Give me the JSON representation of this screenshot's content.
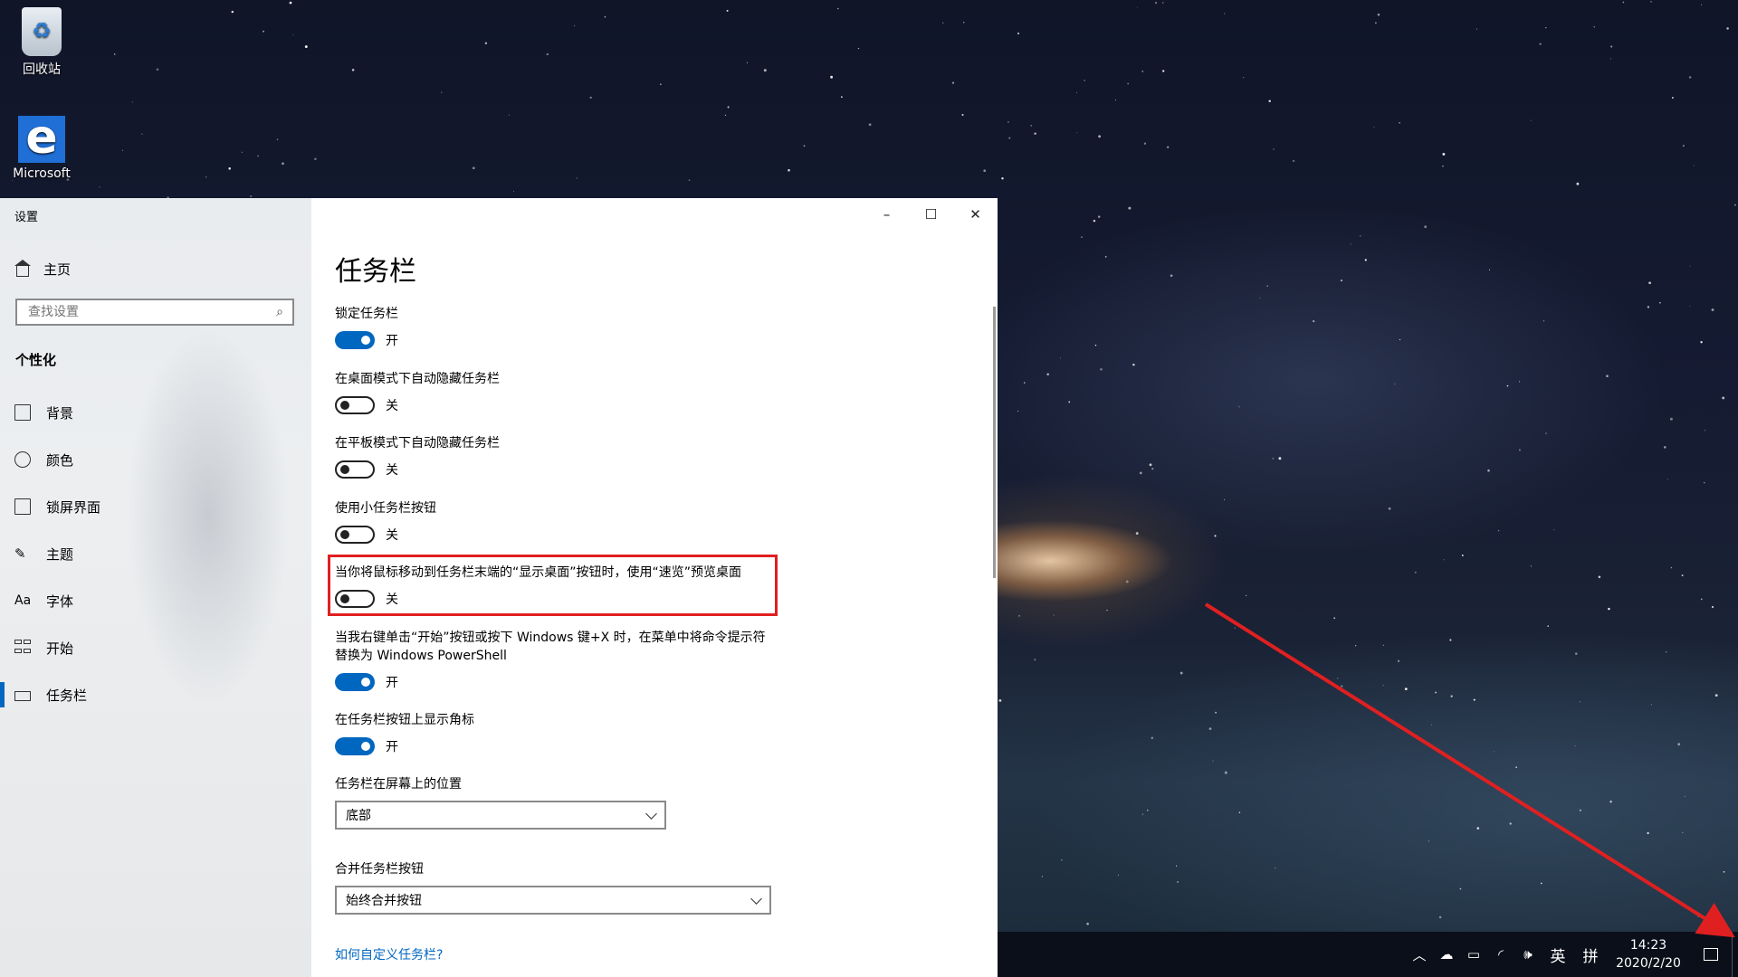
{
  "desktop": {
    "icons": [
      {
        "label": "回收站",
        "icon": "recycle-bin-icon"
      },
      {
        "label": "Microsoft",
        "icon": "edge-icon"
      }
    ]
  },
  "window": {
    "title": "设置",
    "controls": {
      "minimize": "–",
      "maximize": "☐",
      "close": "✕"
    }
  },
  "sidebar": {
    "home_label": "主页",
    "search_placeholder": "查找设置",
    "section_title": "个性化",
    "items": [
      {
        "label": "背景",
        "icon": "picture-icon",
        "active": false
      },
      {
        "label": "颜色",
        "icon": "palette-icon",
        "active": false
      },
      {
        "label": "锁屏界面",
        "icon": "lock-screen-icon",
        "active": false
      },
      {
        "label": "主题",
        "icon": "brush-icon",
        "active": false
      },
      {
        "label": "字体",
        "icon": "font-icon",
        "active": false
      },
      {
        "label": "开始",
        "icon": "start-icon",
        "active": false
      },
      {
        "label": "任务栏",
        "icon": "taskbar-icon",
        "active": true
      }
    ]
  },
  "main": {
    "page_title": "任务栏",
    "toggles": [
      {
        "label": "锁定任务栏",
        "state": "开",
        "on": true
      },
      {
        "label": "在桌面模式下自动隐藏任务栏",
        "state": "关",
        "on": false
      },
      {
        "label": "在平板模式下自动隐藏任务栏",
        "state": "关",
        "on": false
      },
      {
        "label": "使用小任务栏按钮",
        "state": "关",
        "on": false
      },
      {
        "label": "当你将鼠标移动到任务栏末端的“显示桌面”按钮时，使用“速览”预览桌面",
        "state": "关",
        "on": false
      },
      {
        "label": "当我右键单击“开始”按钮或按下 Windows 键+X 时，在菜单中将命令提示符替换为 Windows PowerShell",
        "state": "开",
        "on": true
      },
      {
        "label": "在任务栏按钮上显示角标",
        "state": "开",
        "on": true
      }
    ],
    "position": {
      "label": "任务栏在屏幕上的位置",
      "value": "底部"
    },
    "combine": {
      "label": "合并任务栏按钮",
      "value": "始终合并按钮"
    },
    "help_link": "如何自定义任务栏?"
  },
  "taskbar": {
    "ime_lang": "英",
    "ime_mode": "拼",
    "time": "14:23",
    "date": "2020/2/20"
  },
  "colors": {
    "accent": "#0067c0",
    "annotation": "#e02020"
  }
}
